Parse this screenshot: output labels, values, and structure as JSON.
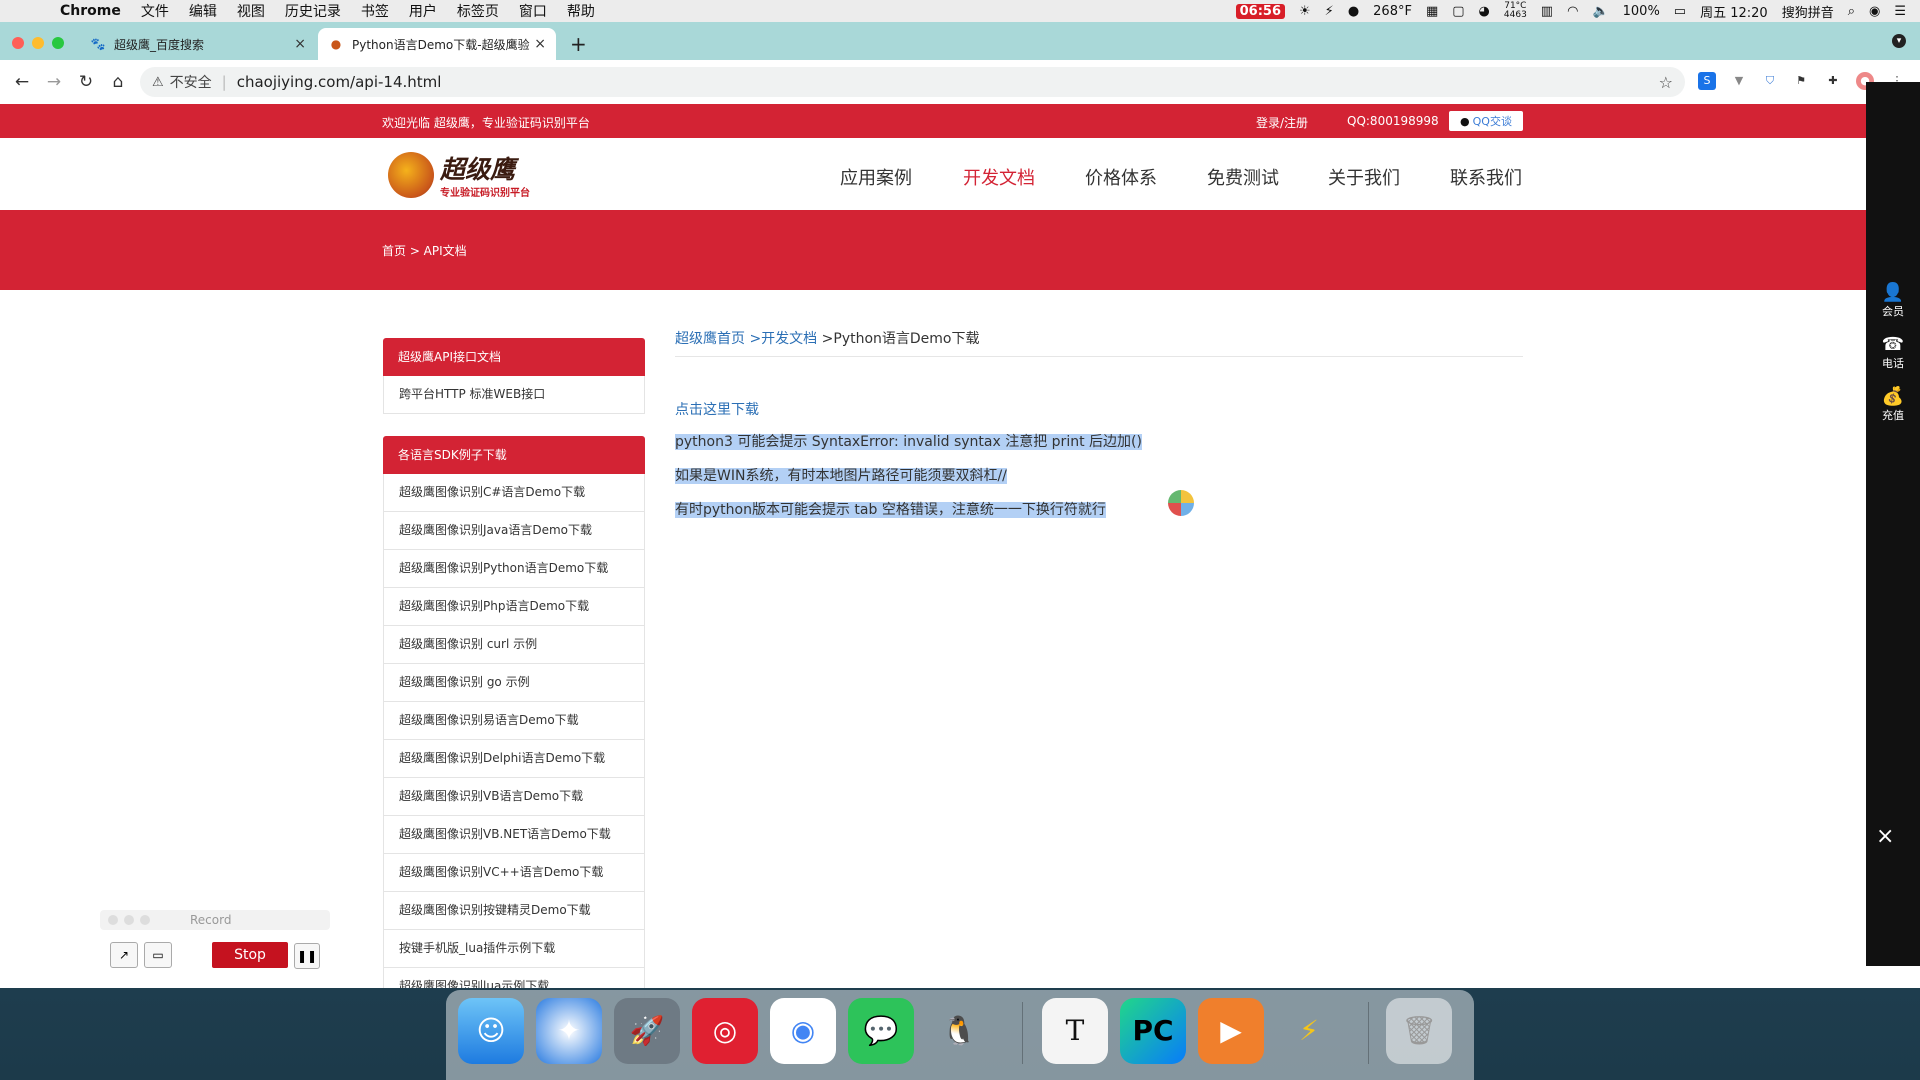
{
  "menubar": {
    "app": "Chrome",
    "menus": [
      "文件",
      "编辑",
      "视图",
      "历史记录",
      "书签",
      "用户",
      "标签页",
      "窗口",
      "帮助"
    ],
    "rec_time": "06:56",
    "temp": "268°F",
    "cpu_top": "71°C",
    "cpu_bottom": "4463",
    "battery": "100%",
    "clock": "周五 12:20",
    "ime": "搜狗拼音"
  },
  "tabs": [
    {
      "title": "超级鹰_百度搜索",
      "close": "×"
    },
    {
      "title": "Python语言Demo下载-超级鹰验",
      "close": "×"
    }
  ],
  "new_tab": "+",
  "address": {
    "insecure": "不安全",
    "url": "chaojiying.com/api-14.html"
  },
  "site": {
    "welcome": "欢迎光临 超级鹰，专业验证码识别平台",
    "login": "登录/注册",
    "qq": "QQ:800198998",
    "qq_button": "QQ交谈",
    "logo_title": "超级鹰",
    "logo_sub": "专业验证码识别平台",
    "nav": [
      "应用案例",
      "开发文档",
      "价格体系",
      "免费测试",
      "关于我们",
      "联系我们"
    ],
    "banner_crumb": "首页 > API文档"
  },
  "sidebar": {
    "section1_title": "超级鹰API接口文档",
    "section1_items": [
      "跨平台HTTP 标准WEB接口"
    ],
    "section2_title": "各语言SDK例子下载",
    "section2_items": [
      "超级鹰图像识别C#语言Demo下载",
      "超级鹰图像识别Java语言Demo下载",
      "超级鹰图像识别Python语言Demo下载",
      "超级鹰图像识别Php语言Demo下载",
      "超级鹰图像识别 curl 示例",
      "超级鹰图像识别 go 示例",
      "超级鹰图像识别易语言Demo下载",
      "超级鹰图像识别Delphi语言Demo下载",
      "超级鹰图像识别VB语言Demo下载",
      "超级鹰图像识别VB.NET语言Demo下载",
      "超级鹰图像识别VC++语言Demo下载",
      "超级鹰图像识别按键精灵Demo下载",
      "按键手机版_lua插件示例下载",
      "超级鹰图像识别lua示例下载"
    ]
  },
  "content": {
    "crumb_home": "超级鹰首页",
    "crumb_docs": ">开发文档",
    "crumb_page": ">Python语言Demo下载",
    "download": "点击这里下载",
    "lines": [
      "python3 可能会提示 SyntaxError: invalid syntax  注意把 print 后边加()",
      "如果是WIN系统，有时本地图片路径可能须要双斜杠//",
      "有时python版本可能会提示 tab 空格错误，注意统一一下换行符就行"
    ]
  },
  "rightbar": [
    "会员",
    "电话",
    "充值"
  ],
  "rightbar_close": "×",
  "record": {
    "label": "Record",
    "stop": "Stop"
  },
  "dock": [
    "finder-icon",
    "safari-icon",
    "launchpad-icon",
    "netease-music-icon",
    "chrome-icon",
    "wechat-icon",
    "qq-icon",
    "typora-icon",
    "pycharm-icon",
    "infuse-icon",
    "reeder-icon",
    "trash-icon"
  ]
}
